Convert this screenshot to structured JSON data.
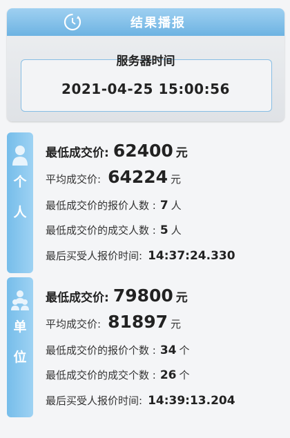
{
  "header": {
    "title": "结果播报"
  },
  "server_time": {
    "label": "服务器时间",
    "value": "2021-04-25 15:00:56"
  },
  "personal": {
    "tab_chars": [
      "个",
      "人"
    ],
    "min_price": {
      "label": "最低成交价:",
      "value": "62400",
      "unit": "元"
    },
    "avg_price": {
      "label": "平均成交价:",
      "value": "64224",
      "unit": "元"
    },
    "bid_count": {
      "label": "最低成交价的报价人数 :",
      "value": "7",
      "unit": "人"
    },
    "deal_count": {
      "label": "最低成交价的成交人数 :",
      "value": "5",
      "unit": "人"
    },
    "last_time": {
      "label": "最后买受人报价时间:",
      "value": "14:37:24.330"
    }
  },
  "unit": {
    "tab_chars": [
      "单",
      "位"
    ],
    "min_price": {
      "label": "最低成交价:",
      "value": "79800",
      "unit": "元"
    },
    "avg_price": {
      "label": "平均成交价:",
      "value": "81897",
      "unit": "元"
    },
    "bid_count": {
      "label": "最低成交价的报价个数 :",
      "value": "34",
      "unit": "个"
    },
    "deal_count": {
      "label": "最低成交价的成交个数 :",
      "value": "26",
      "unit": "个"
    },
    "last_time": {
      "label": "最后买受人报价时间:",
      "value": "14:39:13.204"
    }
  },
  "colors": {
    "accent": "#6db3e2",
    "tab": "#8cc8ef",
    "border": "#86bde4"
  },
  "icons": {
    "header": "clock-refresh-icon",
    "personal": "person-icon",
    "unit": "group-icon"
  }
}
